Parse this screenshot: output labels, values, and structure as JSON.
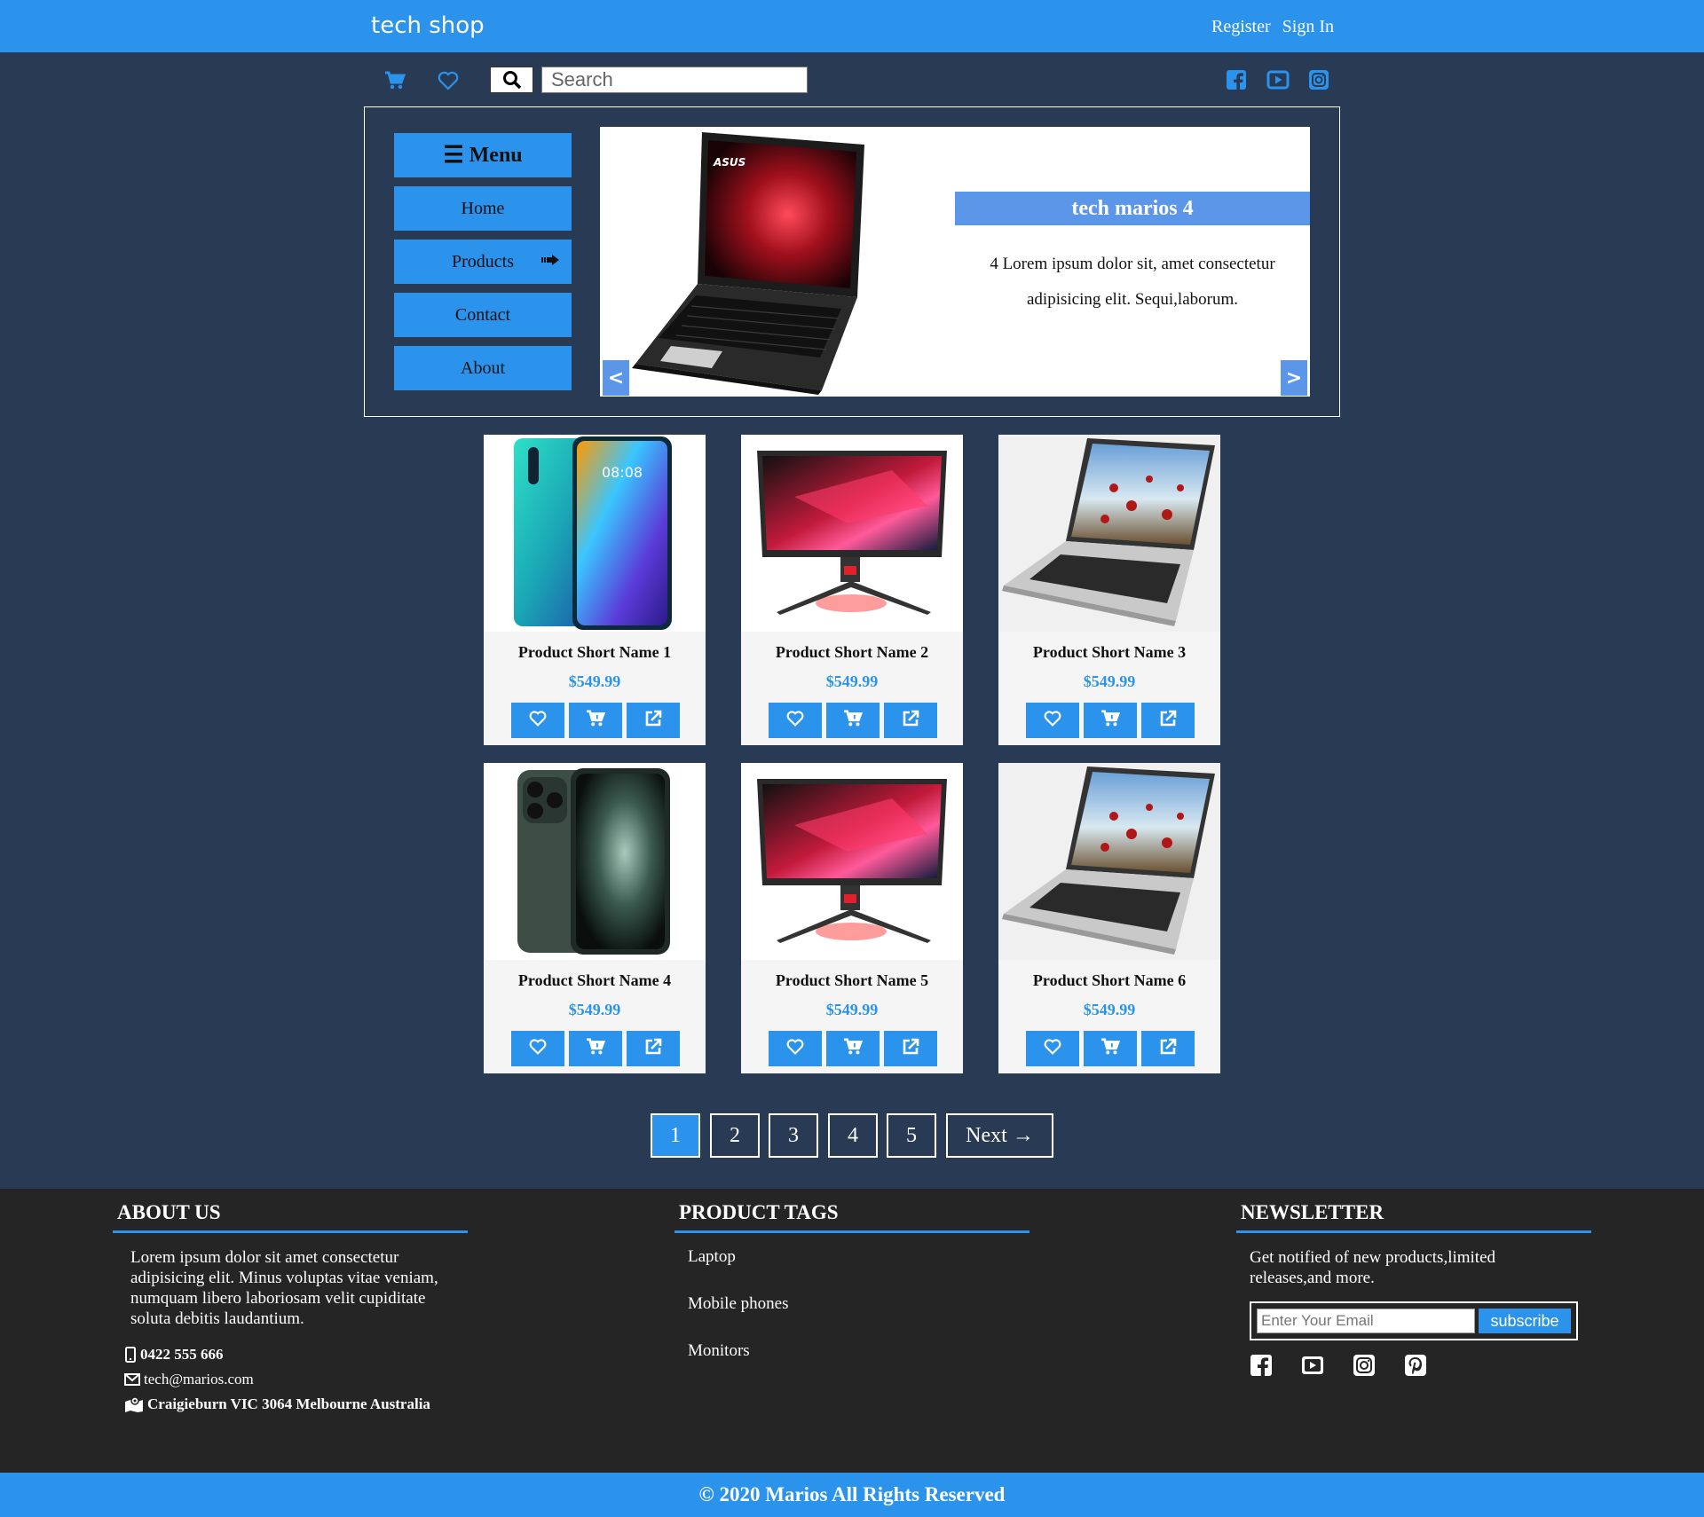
{
  "header": {
    "brand": "tech shop",
    "register": "Register",
    "signin": "Sign In"
  },
  "toolbar": {
    "search_placeholder": "Search"
  },
  "menu": {
    "title": "Menu",
    "items": [
      "Home",
      "Products",
      "Contact",
      "About"
    ]
  },
  "slider": {
    "title": "tech marios 4",
    "text": "4 Lorem ipsum dolor sit, amet consectetur adipisicing elit. Sequi,laborum.",
    "prev": "<",
    "next": ">"
  },
  "products": [
    {
      "name": "Product Short Name 1",
      "price": "$549.99",
      "image": "phone-teal"
    },
    {
      "name": "Product Short Name 2",
      "price": "$549.99",
      "image": "monitor"
    },
    {
      "name": "Product Short Name 3",
      "price": "$549.99",
      "image": "laptop-silver"
    },
    {
      "name": "Product Short Name 4",
      "price": "$549.99",
      "image": "phone-green"
    },
    {
      "name": "Product Short Name 5",
      "price": "$549.99",
      "image": "monitor"
    },
    {
      "name": "Product Short Name 6",
      "price": "$549.99",
      "image": "laptop-silver"
    }
  ],
  "pagination": {
    "pages": [
      "1",
      "2",
      "3",
      "4",
      "5"
    ],
    "next": "Next →",
    "active": "1"
  },
  "footer": {
    "about": {
      "title": "ABOUT US",
      "text": "Lorem ipsum dolor sit amet consectetur adipisicing elit. Minus voluptas vitae veniam, numquam libero laboriosam velit cupiditate soluta debitis laudantium.",
      "phone": "0422 555 666",
      "email": "tech@marios.com",
      "address": "Craigieburn VIC 3064 Melbourne Australia"
    },
    "tags": {
      "title": "PRODUCT TAGS",
      "items": [
        "Laptop",
        "Mobile phones",
        "Monitors"
      ]
    },
    "newsletter": {
      "title": "NEWSLETTER",
      "text": "Get notified of new products,limited releases,and more.",
      "placeholder": "Enter Your Email",
      "button": "subscribe"
    },
    "copyright": "© 2020 Marios All Rights Reserved"
  },
  "colors": {
    "accent": "#2b93eb",
    "page_bg": "#293a54",
    "footer_bg": "#252526",
    "slider_label": "#5b96e8"
  }
}
